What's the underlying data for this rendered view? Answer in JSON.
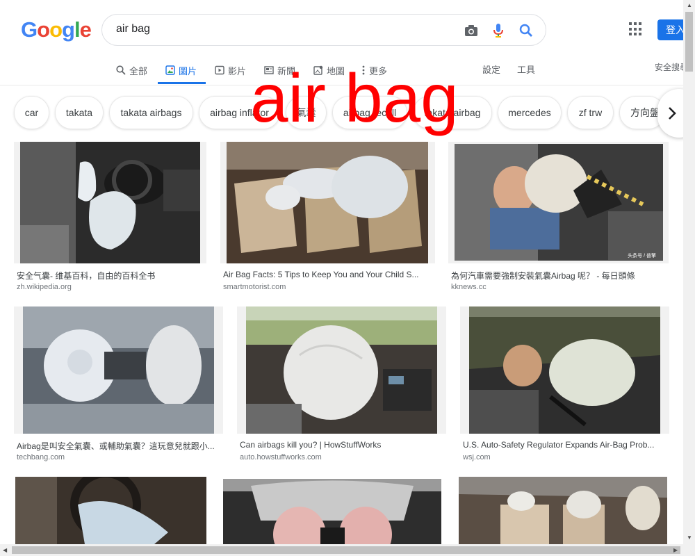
{
  "search": {
    "query": "air bag"
  },
  "logo": {
    "letters": [
      "G",
      "o",
      "o",
      "g",
      "l",
      "e"
    ],
    "colors": [
      "#4285F4",
      "#EA4335",
      "#FBBC05",
      "#4285F4",
      "#34A853",
      "#EA4335"
    ]
  },
  "header": {
    "signin_label": "登入"
  },
  "tabs": [
    {
      "label": "全部",
      "icon": "search-icon"
    },
    {
      "label": "圖片",
      "icon": "image-icon",
      "active": true
    },
    {
      "label": "影片",
      "icon": "video-icon"
    },
    {
      "label": "新聞",
      "icon": "news-icon"
    },
    {
      "label": "地圖",
      "icon": "map-icon"
    },
    {
      "label": "更多",
      "icon": "more-vert-icon"
    }
  ],
  "tools": {
    "settings_label": "設定",
    "tools_label": "工具",
    "safe_search_label": "安全搜尋"
  },
  "chips": [
    "car",
    "takata",
    "takata airbags",
    "airbag inflator",
    "氣囊",
    "airbag recall",
    "takata airbag",
    "mercedes",
    "zf trw",
    "方向盤"
  ],
  "overlay_text": "air bag",
  "results": [
    {
      "title": "安全气囊- 维基百科，自由的百科全书",
      "source": "zh.wikipedia.org"
    },
    {
      "title": "Air Bag Facts: 5 Tips to Keep You and Your Child S...",
      "source": "smartmotorist.com"
    },
    {
      "title": "為何汽車需要強制安裝氣囊Airbag 呢？ - 每日頭條",
      "source": "kknews.cc",
      "watermark": "头条号 / 普擎"
    },
    {
      "title": "Airbag是叫安全氣囊、或輔助氣囊？這玩意兒就跟小...",
      "source": "techbang.com"
    },
    {
      "title": "Can airbags kill you? | HowStuffWorks",
      "source": "auto.howstuffworks.com"
    },
    {
      "title": "U.S. Auto-Safety Regulator Expands Air-Bag Prob...",
      "source": "wsj.com"
    },
    {
      "title": "",
      "source": ""
    },
    {
      "title": "",
      "source": ""
    },
    {
      "title": "",
      "source": ""
    }
  ],
  "colors": {
    "accent": "#1a73e8",
    "overlay": "#ff0000"
  }
}
